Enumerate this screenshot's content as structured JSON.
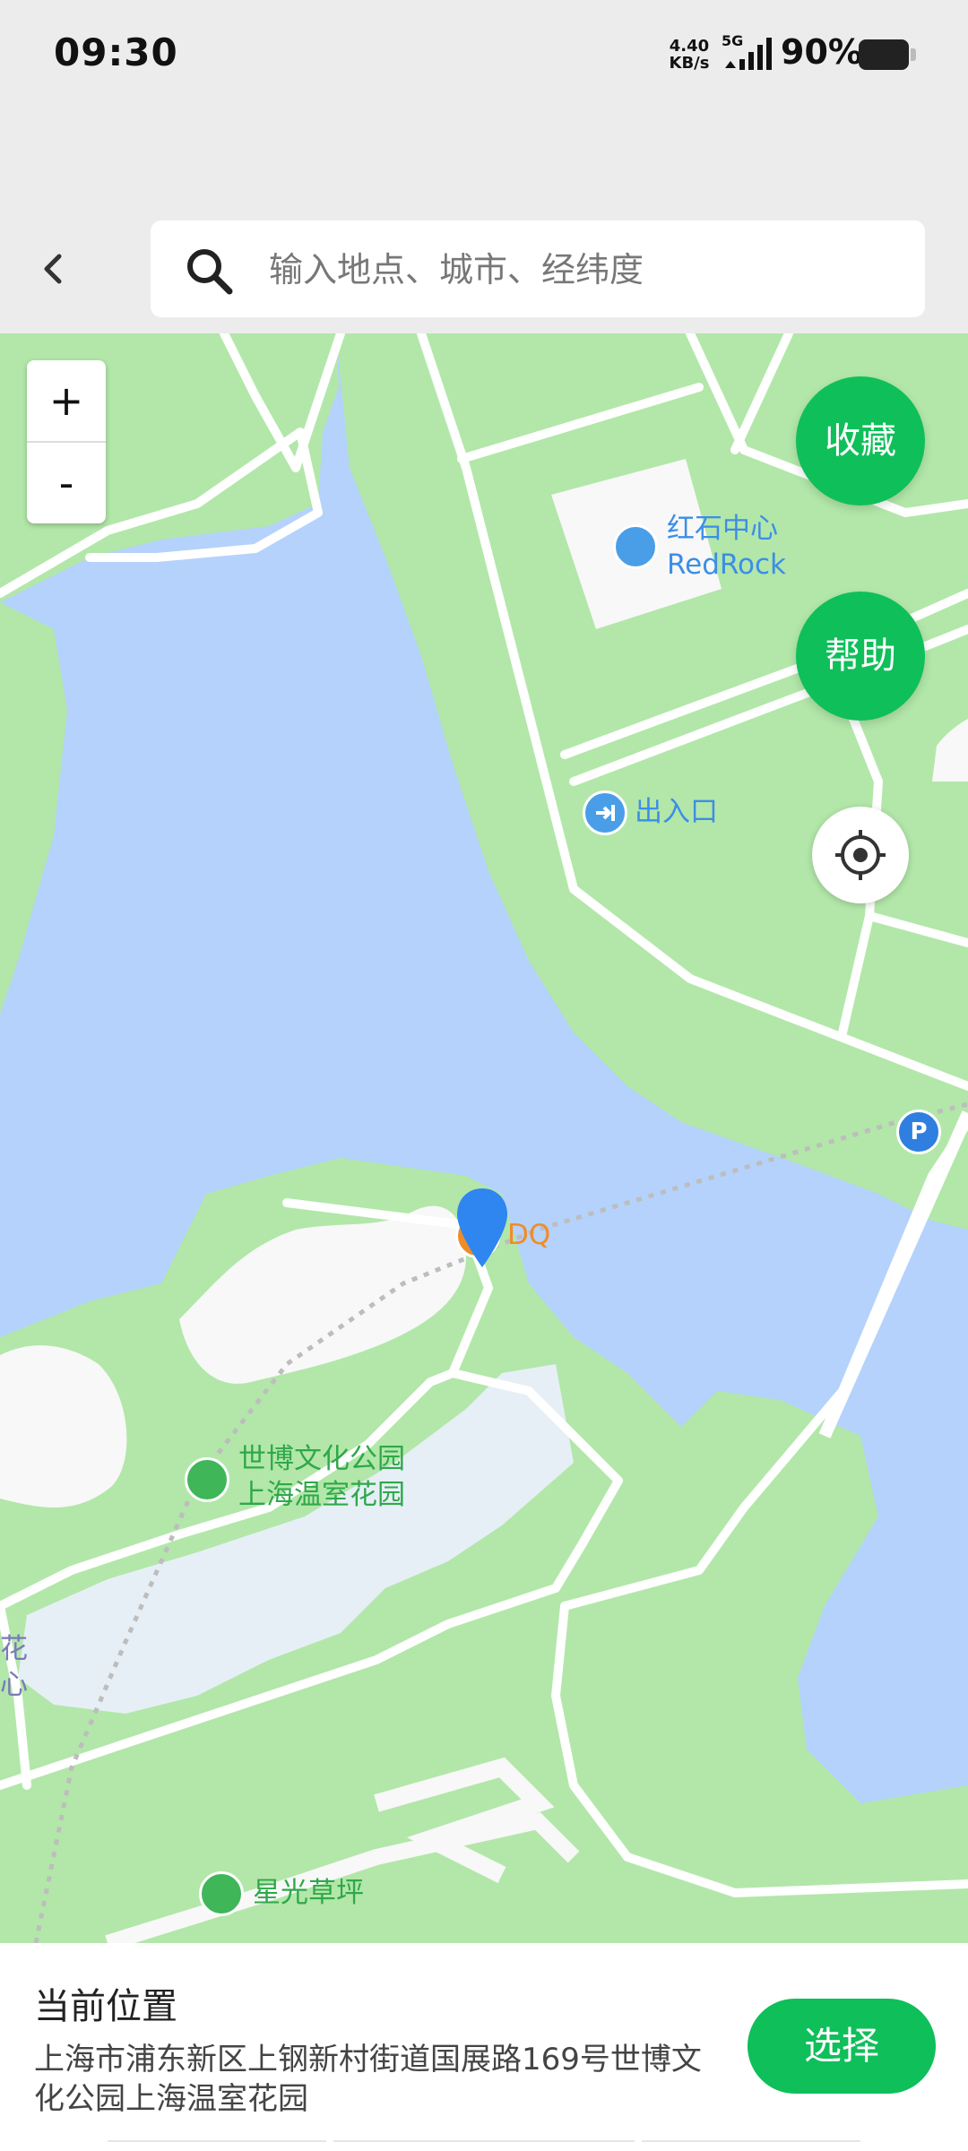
{
  "status_bar": {
    "time": "09:30",
    "net_speed": "4.40",
    "net_unit": "KB/s",
    "network_type": "5G",
    "battery_percent": "90%"
  },
  "header": {
    "search_placeholder": "输入地点、城市、经纬度"
  },
  "map": {
    "zoom_in": "+",
    "zoom_out": "-",
    "favorites_label": "收藏",
    "help_label": "帮助",
    "pois": {
      "redrock_cn": "红石中心",
      "redrock_en": "RedRock",
      "entrance": "出入口",
      "dq": "DQ",
      "park_line1": "世博文化公园",
      "park_line2": "上海温室花园",
      "lawn": "星光草坪",
      "edge_partial_1": "花",
      "edge_partial_2": "心"
    },
    "colors": {
      "water": "#b4d2fb",
      "green": "#b2e7a9",
      "road": "#ffffff",
      "accent": "#0fbf5a",
      "pin": "#2f86f0"
    }
  },
  "panel": {
    "title": "当前位置",
    "address": "上海市浦东新区上钢新村街道国展路169号世博文化公园上海温室花园",
    "select_label": "选择"
  }
}
